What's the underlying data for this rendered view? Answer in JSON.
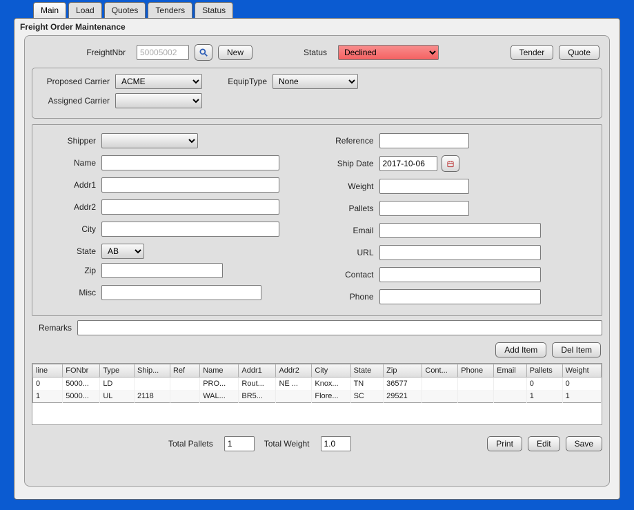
{
  "tabs": [
    "Main",
    "Load",
    "Quotes",
    "Tenders",
    "Status"
  ],
  "activeTab": "Main",
  "title": "Freight Order Maintenance",
  "top": {
    "freightNbrLabel": "FreightNbr",
    "freightNbr": "50005002",
    "newLabel": "New",
    "statusLabel": "Status",
    "statusValue": "Declined",
    "statusOptions": [
      "Declined"
    ],
    "tenderLabel": "Tender",
    "quoteLabel": "Quote"
  },
  "carrier": {
    "proposedLabel": "Proposed Carrier",
    "proposedValue": "ACME",
    "proposedOptions": [
      "ACME"
    ],
    "equipLabel": "EquipType",
    "equipValue": "None",
    "equipOptions": [
      "None"
    ],
    "assignedLabel": "Assigned Carrier",
    "assignedValue": "",
    "assignedOptions": [
      ""
    ]
  },
  "left": {
    "shipperLabel": "Shipper",
    "shipperValue": "",
    "nameLabel": "Name",
    "nameValue": "",
    "addr1Label": "Addr1",
    "addr1Value": "",
    "addr2Label": "Addr2",
    "addr2Value": "",
    "cityLabel": "City",
    "cityValue": "",
    "stateLabel": "State",
    "stateValue": "AB",
    "stateOptions": [
      "AB"
    ],
    "zipLabel": "Zip",
    "zipValue": "",
    "miscLabel": "Misc",
    "miscValue": ""
  },
  "right": {
    "referenceLabel": "Reference",
    "referenceValue": "",
    "shipDateLabel": "Ship Date",
    "shipDateValue": "2017-10-06",
    "weightLabel": "Weight",
    "weightValue": "",
    "palletsLabel": "Pallets",
    "palletsValue": "",
    "emailLabel": "Email",
    "emailValue": "",
    "urlLabel": "URL",
    "urlValue": "",
    "contactLabel": "Contact",
    "contactValue": "",
    "phoneLabel": "Phone",
    "phoneValue": ""
  },
  "remarksLabel": "Remarks",
  "remarksValue": "",
  "items": {
    "addLabel": "Add Item",
    "delLabel": "Del Item"
  },
  "table": {
    "headers": [
      "line",
      "FONbr",
      "Type",
      "Ship...",
      "Ref",
      "Name",
      "Addr1",
      "Addr2",
      "City",
      "State",
      "Zip",
      "Cont...",
      "Phone",
      "Email",
      "Pallets",
      "Weight"
    ],
    "rows": [
      {
        "line": "0",
        "FONbr": "5000...",
        "Type": "LD",
        "Ship": "",
        "Ref": "",
        "Name": "PRO...",
        "Addr1": "Rout...",
        "Addr2": "NE ...",
        "City": "Knox...",
        "State": "TN",
        "Zip": "36577",
        "Cont": "",
        "Phone": "",
        "Email": "",
        "Pallets": "0",
        "Weight": "0"
      },
      {
        "line": "1",
        "FONbr": "5000...",
        "Type": "UL",
        "Ship": "2118",
        "Ref": "",
        "Name": "WAL...",
        "Addr1": "BR5...",
        "Addr2": "",
        "City": "Flore...",
        "State": "SC",
        "Zip": "29521",
        "Cont": "",
        "Phone": "",
        "Email": "",
        "Pallets": "1",
        "Weight": "1"
      }
    ]
  },
  "footer": {
    "totalPalletsLabel": "Total Pallets",
    "totalPalletsValue": "1",
    "totalWeightLabel": "Total Weight",
    "totalWeightValue": "1.0",
    "printLabel": "Print",
    "editLabel": "Edit",
    "saveLabel": "Save"
  }
}
